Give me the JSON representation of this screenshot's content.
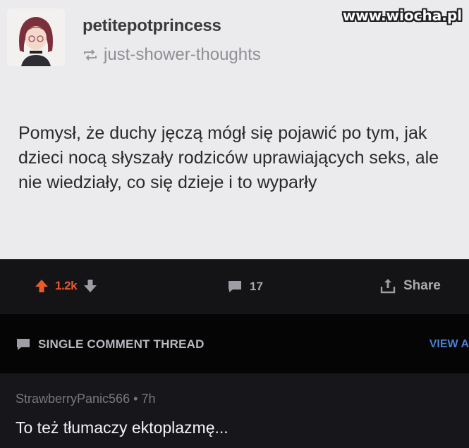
{
  "watermark": "www.wiocha.pl",
  "post": {
    "username": "petitepotprincess",
    "reblogged_from": "just-shower-thoughts",
    "avatar_icon": "anime-girl-avatar",
    "reblog_icon": "reblog-icon",
    "text": "Pomysł, że duchy jęczą mógł się pojawić po tym, jak dzieci nocą słyszały rodziców uprawiających seks, ale nie wiedziały, co się dzieje i to wyparły"
  },
  "actions": {
    "score": "1.2k",
    "comment_count": "17",
    "share_label": "Share",
    "upvote_color": "#e85a2c"
  },
  "thread": {
    "title": "SINGLE COMMENT THREAD",
    "view_all": "VIEW A"
  },
  "comment": {
    "author": "StrawberryPanic566",
    "separator": "•",
    "age": "7h",
    "body": "To też tłumaczy ektoplazmę..."
  }
}
